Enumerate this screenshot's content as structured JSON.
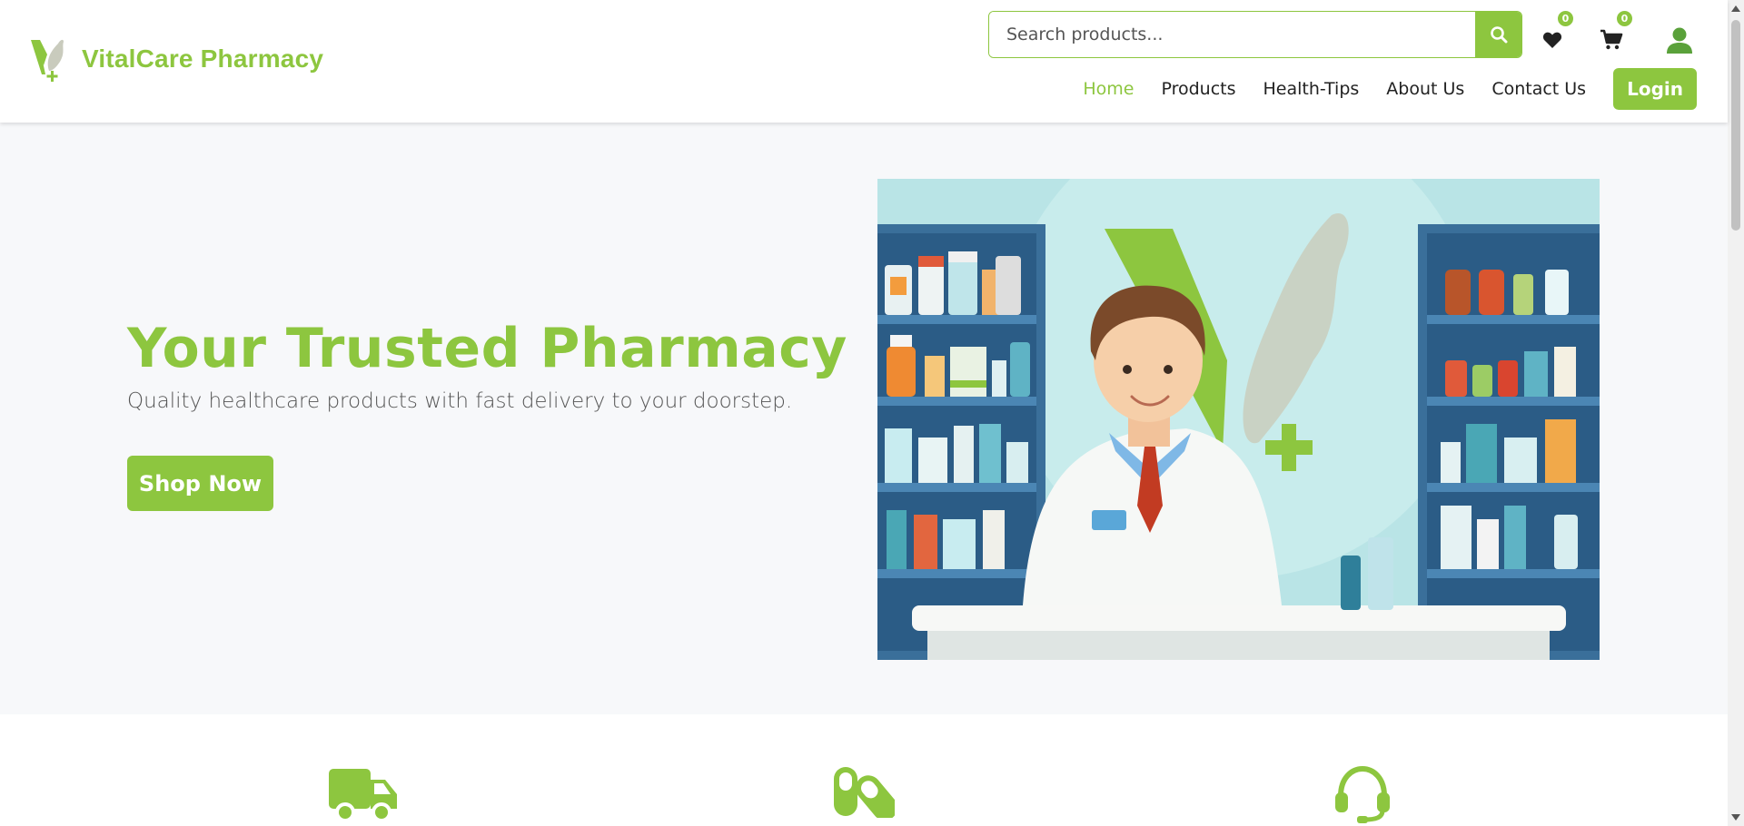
{
  "brand": {
    "name": "VitalCare Pharmacy",
    "color": "#8dc63f"
  },
  "search": {
    "placeholder": "Search products..."
  },
  "header_icons": {
    "wishlist": {
      "icon": "heart-icon",
      "count": "0"
    },
    "cart": {
      "icon": "cart-icon",
      "count": "0"
    },
    "account": {
      "icon": "user-icon"
    }
  },
  "nav": {
    "items": [
      {
        "label": "Home",
        "active": true
      },
      {
        "label": "Products"
      },
      {
        "label": "Health-Tips"
      },
      {
        "label": "About Us"
      },
      {
        "label": "Contact Us"
      }
    ],
    "login": "Login"
  },
  "hero": {
    "title": "Your Trusted Pharmacy",
    "subtitle": "Quality healthcare products with fast delivery to your doorstep.",
    "cta": "Shop Now",
    "illustration": "pharmacist-at-counter-illustration"
  },
  "features": {
    "icons": [
      "truck-icon",
      "pills-icon",
      "headset-icon"
    ]
  }
}
